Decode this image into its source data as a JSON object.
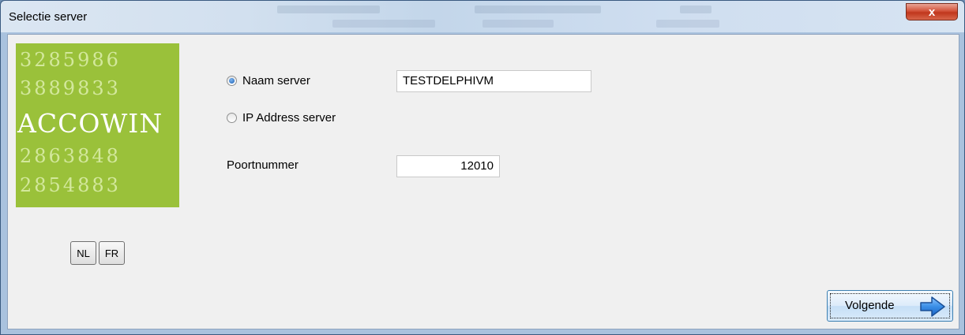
{
  "window": {
    "title": "Selectie server",
    "close_label": "x"
  },
  "logo": {
    "rows": [
      "3285986",
      "3889833",
      "2863848",
      "2854883"
    ],
    "brand": "ACCOWIN"
  },
  "language_buttons": {
    "nl": "NL",
    "fr": "FR"
  },
  "server_mode": {
    "options": [
      {
        "label": "Naam server",
        "selected": true
      },
      {
        "label": "IP Address server",
        "selected": false
      }
    ]
  },
  "fields": {
    "server_name": "TESTDELPHIVM",
    "port_label": "Poortnummer",
    "port_value": "12010"
  },
  "actions": {
    "next_label": "Volgende"
  },
  "colors": {
    "logo_bg": "#9ac13a",
    "arrow": "#3a8ee6"
  }
}
